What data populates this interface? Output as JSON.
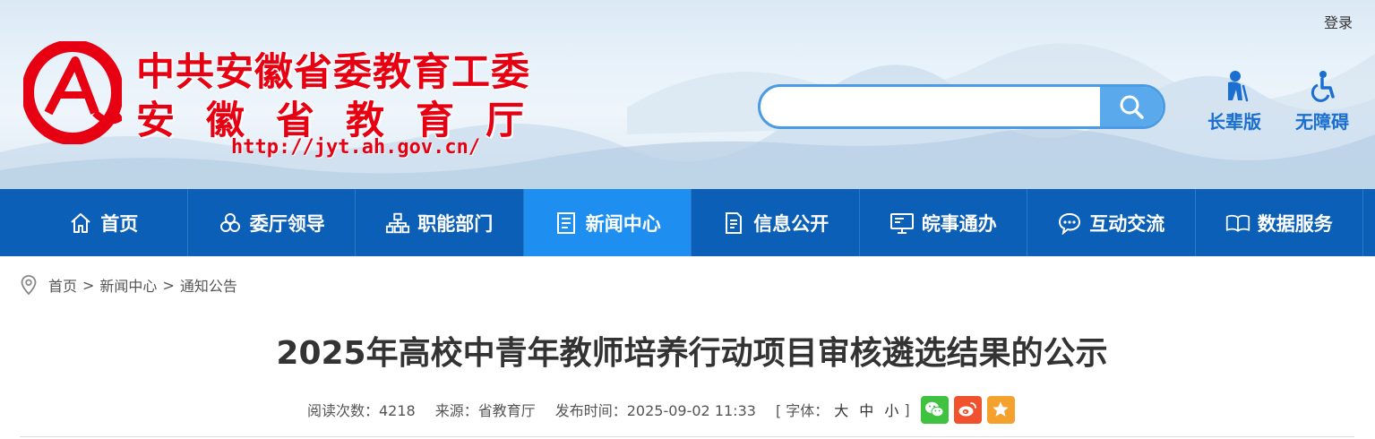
{
  "header": {
    "login_label": "登录",
    "logo_line1": "中共安徽省委教育工委",
    "logo_line2": "安徽省教育厅",
    "logo_url": "http://jyt.ah.gov.cn/",
    "search_placeholder": "",
    "elder_label": "长辈版",
    "accessible_label": "无障碍",
    "brand_red": "#e60012",
    "accent_blue": "#1a6fd0"
  },
  "nav": {
    "items": [
      {
        "label": "首页",
        "icon": "home-icon"
      },
      {
        "label": "委厅领导",
        "icon": "people-icon"
      },
      {
        "label": "职能部门",
        "icon": "org-chart-icon"
      },
      {
        "label": "新闻中心",
        "icon": "document-icon"
      },
      {
        "label": "信息公开",
        "icon": "file-list-icon"
      },
      {
        "label": "皖事通办",
        "icon": "monitor-icon"
      },
      {
        "label": "互动交流",
        "icon": "chat-icon"
      },
      {
        "label": "数据服务",
        "icon": "book-icon"
      }
    ],
    "active": "新闻中心",
    "bar_color": "#0b5fb6",
    "active_color": "#1e8ff0"
  },
  "breadcrumb": {
    "items": [
      "首页",
      "新闻中心",
      "通知公告"
    ],
    "separator": ">"
  },
  "article": {
    "title": "2025年高校中青年教师培养行动项目审核遴选结果的公示",
    "views": "阅读次数：4218",
    "source": "来源：省教育厅",
    "published": "发布时间：2025-09-02 11:33",
    "font_size_prefix": "[ 字体：",
    "font_large": "大",
    "font_medium": "中",
    "font_small": "小",
    "font_size_suffix": "]",
    "share": [
      "wechat-icon",
      "weibo-icon",
      "star-icon"
    ]
  }
}
